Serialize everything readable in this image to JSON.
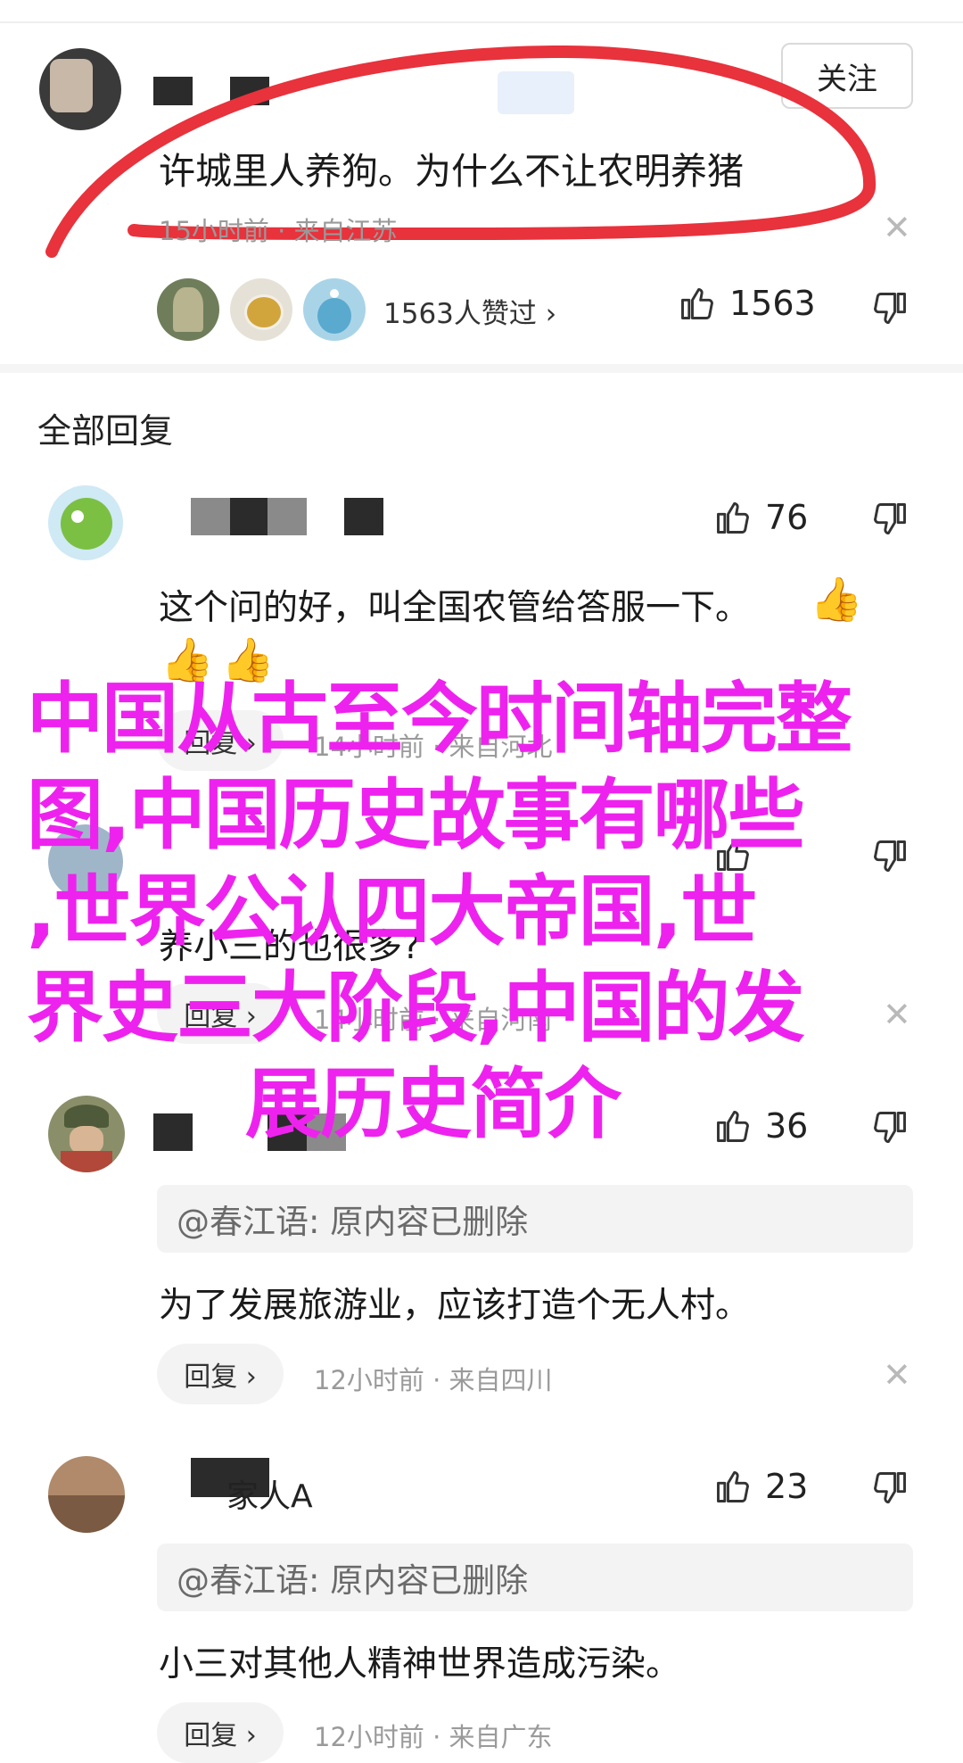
{
  "top_comment": {
    "comment": "许城里人养狗。为什么不让农明养猪",
    "meta": "15小时前 · 来自江苏",
    "follow_label": "关注",
    "likers_text": "1563人赞过 ›",
    "likes": "1563"
  },
  "section_title": "全部回复",
  "replies": [
    {
      "text": "这个问的好，叫全国农管给答服一下。",
      "likes": "76",
      "reply_label": "回复 ›",
      "meta": "14小时前 · 来自河北",
      "emojis": [
        "👍",
        "👍",
        "👍"
      ]
    },
    {
      "text": "养小三的也很多?",
      "likes": "",
      "reply_label": "回复 ›",
      "meta": "14小时前 · 来自河南"
    },
    {
      "text": "为了发展旅游业，应该打造个无人村。",
      "likes": "36",
      "quote": "@春江语: 原内容已删除",
      "reply_label": "回复 ›",
      "meta": "12小时前 · 来自四川"
    },
    {
      "name_visible": "家人A",
      "text": "小三对其他人精神世界造成污染。",
      "likes": "23",
      "quote": "@春江语: 原内容已删除",
      "reply_label": "回复 ›",
      "meta": "12小时前 · 来自广东"
    }
  ],
  "overlay_title": [
    "中国从古至今时间轴完整",
    "图,中国历史故事有哪些",
    ",世界公认四大帝国,世",
    "界史三大阶段,中国的发",
    "展历史简介"
  ],
  "colors": {
    "overlay": "#ee22ee",
    "annotation": "#e8323c"
  },
  "icons": {
    "like": "thumbs-up-icon",
    "dislike": "thumbs-down-icon",
    "close": "close-icon",
    "chevron": "chevron-right-icon"
  }
}
